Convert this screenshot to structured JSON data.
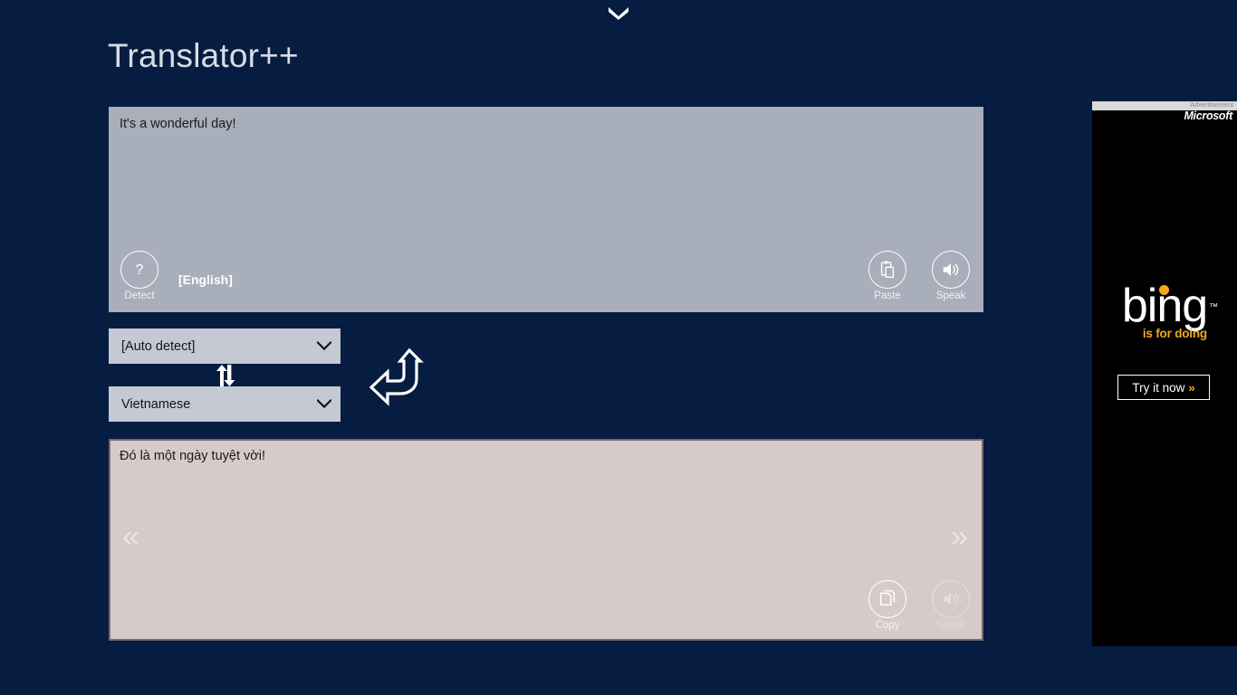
{
  "app": {
    "title": "Translator++",
    "background_color": "#061c40"
  },
  "top_bar": {
    "chevron_icon": "chevron-down-icon"
  },
  "source": {
    "text": "It's a wonderful day!",
    "background_color": "#a8aeba",
    "detect_button": {
      "label": "Detect",
      "icon": "question-mark-icon"
    },
    "detected_language": "[English]",
    "paste_button": {
      "label": "Paste",
      "icon": "clipboard-icon"
    },
    "speak_button": {
      "label": "Speak",
      "icon": "speaker-icon"
    }
  },
  "languages": {
    "from": "[Auto detect]",
    "to": "Vietnamese",
    "swap_icon": "swap-arrows-icon",
    "translate_icon": "curved-arrow-icon",
    "chevron_icon": "chevron-down-icon"
  },
  "target": {
    "text": "Đó là một ngày tuyệt vời!",
    "background_color": "#d7cbc9",
    "prev_label": "«",
    "next_label": "»",
    "copy_button": {
      "label": "Copy",
      "icon": "copy-icon"
    },
    "speak_button": {
      "label": "Speak",
      "icon": "speaker-icon",
      "disabled": true
    }
  },
  "advertisement": {
    "label": "Advertisement",
    "brand": "Microsoft",
    "logo_text": "bing",
    "tagline": "is for doing",
    "trademark": "™",
    "cta_text": "Try it now",
    "cta_chevron": "»",
    "accent_color": "#f7a71c",
    "background_color": "#000000"
  }
}
